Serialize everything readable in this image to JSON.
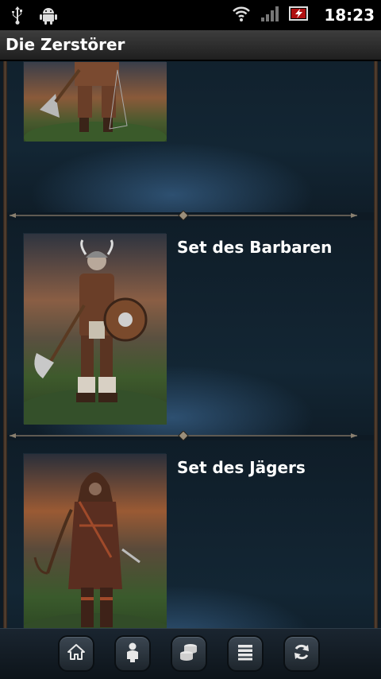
{
  "status_bar": {
    "time": "18:23",
    "icons": [
      "usb-icon",
      "android-debug-icon",
      "wifi-icon",
      "signal-icon",
      "battery-charging-icon"
    ]
  },
  "app": {
    "title": "Die Zerstörer"
  },
  "items": [
    {
      "name": "",
      "image": "warrior-portrait"
    },
    {
      "name": "Set des Barbaren",
      "image": "barbarian-portrait"
    },
    {
      "name": "Set des Jägers",
      "image": "hunter-portrait"
    }
  ],
  "bottom_nav": [
    {
      "icon": "home-icon"
    },
    {
      "icon": "person-icon"
    },
    {
      "icon": "coins-icon"
    },
    {
      "icon": "list-icon"
    },
    {
      "icon": "refresh-icon"
    }
  ],
  "colors": {
    "content_bg": "#0e1a24",
    "title_text": "#ffffff",
    "glow": "#4678aa"
  }
}
